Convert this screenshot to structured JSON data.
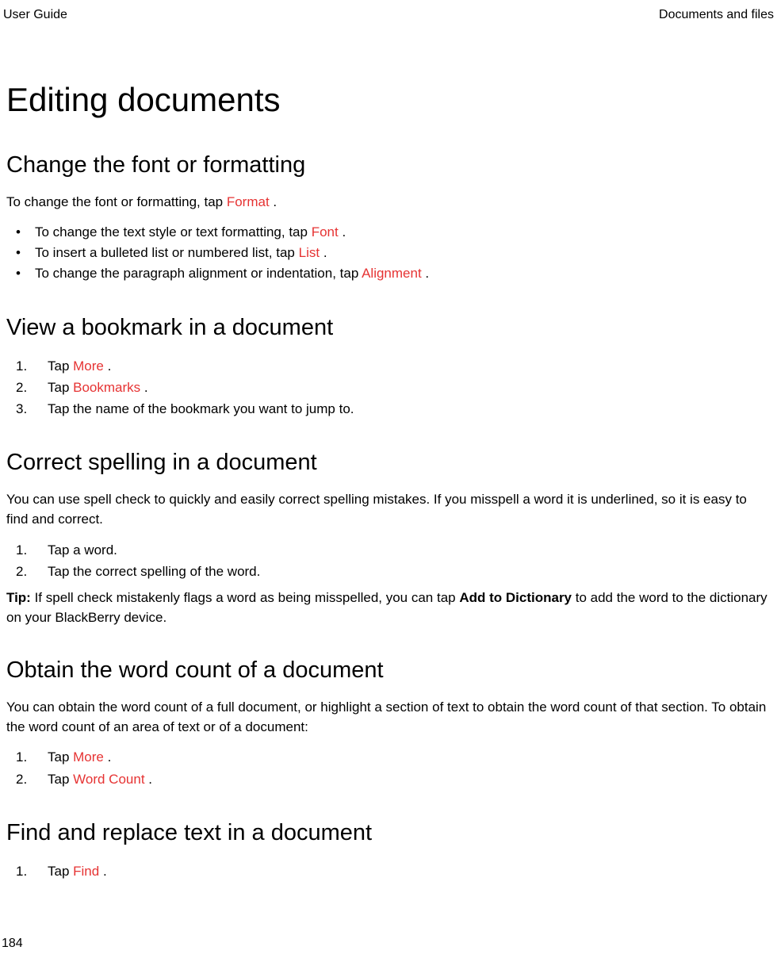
{
  "header": {
    "left": "User Guide",
    "right": "Documents and files"
  },
  "title": "Editing documents",
  "sections": {
    "changeFont": {
      "heading": "Change the font or formatting",
      "intro_before": "To change the font or formatting, tap ",
      "intro_highlight": "Format",
      "intro_after": " .",
      "items": [
        {
          "before": "To change the text style or text formatting, tap ",
          "highlight": "Font",
          "after": " ."
        },
        {
          "before": "To insert a bulleted list or numbered list, tap ",
          "highlight": "List",
          "after": " ."
        },
        {
          "before": "To change the paragraph alignment or indentation, tap ",
          "highlight": "Alignment",
          "after": " ."
        }
      ]
    },
    "viewBookmark": {
      "heading": "View a bookmark in a document",
      "items": [
        {
          "before": "Tap ",
          "highlight": "More",
          "after": " ."
        },
        {
          "before": "Tap ",
          "highlight": "Bookmarks",
          "after": " ."
        },
        {
          "before": "Tap the name of the bookmark you want to jump to.",
          "highlight": "",
          "after": ""
        }
      ]
    },
    "correctSpelling": {
      "heading": "Correct spelling in a document",
      "intro": "You can use spell check to quickly and easily correct spelling mistakes. If you misspell a word it is underlined, so it is easy to find and correct.",
      "items": [
        {
          "text": "Tap a word."
        },
        {
          "text": "Tap the correct spelling of the word."
        }
      ],
      "tip_label": "Tip: ",
      "tip_before": "If spell check mistakenly flags a word as being misspelled, you can tap ",
      "tip_bold": "Add to Dictionary",
      "tip_after": " to add the word to the dictionary on your BlackBerry device."
    },
    "wordCount": {
      "heading": "Obtain the word count of a document",
      "intro": "You can obtain the word count of a full document, or highlight a section of text to obtain the word count of that section. To obtain the word count of an area of text or of a document:",
      "items": [
        {
          "before": "Tap ",
          "highlight": "More",
          "after": " ."
        },
        {
          "before": "Tap ",
          "highlight": "Word Count",
          "after": " ."
        }
      ]
    },
    "findReplace": {
      "heading": "Find and replace text in a document",
      "items": [
        {
          "before": "Tap ",
          "highlight": "Find",
          "after": " ."
        }
      ]
    }
  },
  "pageNumber": "184"
}
